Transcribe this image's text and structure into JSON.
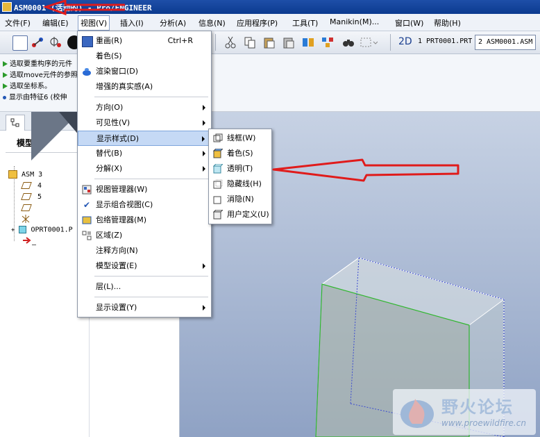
{
  "window": {
    "title": "ASM0001 (活动的) - Pro/ENGINEER"
  },
  "menubar": [
    {
      "label": "文件(F)"
    },
    {
      "label": "编辑(E)"
    },
    {
      "label": "视图(V)"
    },
    {
      "label": "插入(I)"
    },
    {
      "label": "分析(A)"
    },
    {
      "label": "信息(N)"
    },
    {
      "label": "应用程序(P)"
    },
    {
      "label": "工具(T)"
    },
    {
      "label": "Manikin(M)..."
    },
    {
      "label": "窗口(W)"
    },
    {
      "label": "帮助(H)"
    }
  ],
  "toolbar": {
    "label_2d": "2D",
    "window_tabs": [
      "1 PRT0001.PRT",
      "2 ASM0001.ASM"
    ]
  },
  "messages": [
    {
      "kind": "prompt",
      "text": "选取要重构序的元件"
    },
    {
      "kind": "prompt",
      "text": "选取move元件的参照"
    },
    {
      "kind": "prompt",
      "text": "选取坐标系。"
    },
    {
      "kind": "info",
      "text": "显示由特征6 (校伸"
    }
  ],
  "left_panel": {
    "heading": "模型",
    "tree": [
      {
        "text": "ASM",
        "suffix": "3"
      },
      {
        "text": "4"
      },
      {
        "text": "5"
      },
      {
        "text": ""
      },
      {
        "text": ""
      },
      {
        "text": "OPRT0001.P"
      },
      {
        "text": "—"
      }
    ]
  },
  "view_menu": {
    "items": [
      {
        "label": "重画(R)",
        "shortcut": "Ctrl+R",
        "icon": "repaint-icon"
      },
      {
        "label": "着色(S)"
      },
      {
        "label": "渲染窗口(D)",
        "icon": "render-teapot-icon"
      },
      {
        "label": "增强的真实感(A)"
      },
      {
        "label": "方向(O)",
        "submenu": true
      },
      {
        "label": "可见性(V)",
        "submenu": true
      },
      {
        "label": "显示样式(D)",
        "submenu": true,
        "highlighted": true
      },
      {
        "label": "替代(B)",
        "submenu": true
      },
      {
        "label": "分解(X)",
        "submenu": true
      },
      {
        "label": "视图管理器(W)",
        "icon": "view-manager-icon"
      },
      {
        "label": "显示组合视图(C)",
        "checked": true
      },
      {
        "label": "包络管理器(M)",
        "icon": "envelope-manager-icon"
      },
      {
        "label": "区域(Z)",
        "icon": "zone-icon"
      },
      {
        "label": "注释方向(N)"
      },
      {
        "label": "模型设置(E)",
        "submenu": true
      },
      {
        "label": "层(L)..."
      },
      {
        "label": "显示设置(Y)",
        "submenu": true
      }
    ]
  },
  "display_style_submenu": {
    "items": [
      {
        "label": "线框(W)",
        "icon": "wireframe-icon"
      },
      {
        "label": "着色(S)",
        "icon": "shaded-icon"
      },
      {
        "label": "透明(T)",
        "icon": "transparent-icon"
      },
      {
        "label": "隐藏线(H)",
        "icon": "hidden-line-icon"
      },
      {
        "label": "消隐(N)",
        "icon": "no-hidden-icon"
      },
      {
        "label": "用户定义(U)",
        "icon": "user-defined-icon"
      }
    ]
  },
  "watermark": {
    "title": "野火论坛",
    "url": "www.proewildfire.cn"
  },
  "colors": {
    "title_bar": "#0b3a8f",
    "menu_highlight": "#c5d9f5",
    "annotation_red": "#e01b1b",
    "model_edge_green": "#2fb52f",
    "viewport_top": "#c7d2e4",
    "viewport_bottom": "#8fa2c4"
  }
}
